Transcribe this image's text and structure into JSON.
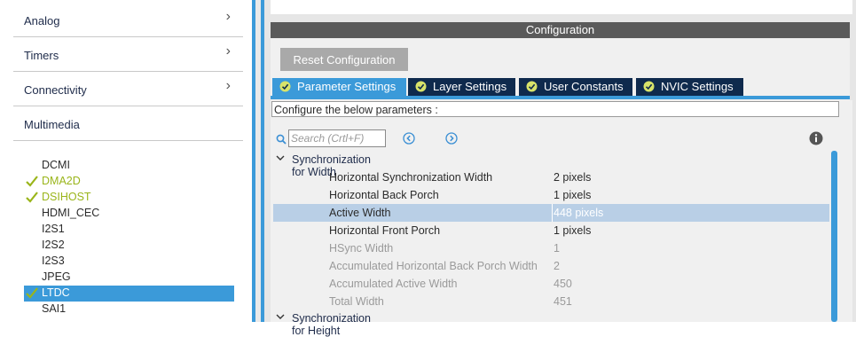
{
  "left_panel": {
    "categories": [
      {
        "label": "Analog",
        "chevron": true
      },
      {
        "label": "Timers",
        "chevron": true
      },
      {
        "label": "Connectivity",
        "chevron": true
      },
      {
        "label": "Multimedia",
        "chevron": false
      }
    ],
    "multimedia_items": [
      {
        "label": "DCMI",
        "status": "none"
      },
      {
        "label": "DMA2D",
        "status": "ok"
      },
      {
        "label": "DSIHOST",
        "status": "ok"
      },
      {
        "label": "HDMI_CEC",
        "status": "none"
      },
      {
        "label": "I2S1",
        "status": "none"
      },
      {
        "label": "I2S2",
        "status": "none"
      },
      {
        "label": "I2S3",
        "status": "none"
      },
      {
        "label": "JPEG",
        "status": "none"
      },
      {
        "label": "LTDC",
        "status": "ok-selected"
      },
      {
        "label": "SAI1",
        "status": "none"
      }
    ],
    "icons": {
      "chevron": "chevron-right-icon",
      "check": "check-icon"
    },
    "colors": {
      "selected_bg": "#3b9ad9",
      "ok_text": "#9ab51a"
    }
  },
  "config": {
    "header": "Configuration",
    "reset_label": "Reset Configuration",
    "tabs": [
      {
        "label": "Parameter Settings",
        "active": true
      },
      {
        "label": "Layer Settings",
        "active": false
      },
      {
        "label": "User Constants",
        "active": false
      },
      {
        "label": "NVIC Settings",
        "active": false
      }
    ],
    "instruction": "Configure the below parameters :",
    "search_placeholder": "Search (Crtl+F)",
    "icons": {
      "search": "search-icon",
      "prev": "previous-icon",
      "next": "next-icon",
      "info": "info-icon",
      "tab_check": "check-circle-icon"
    },
    "groups": [
      {
        "label": "Synchronization for Width",
        "params": [
          {
            "name": "Horizontal Synchronization Width",
            "value": "2 pixels",
            "dim": false
          },
          {
            "name": "Horizontal Back Porch",
            "value": "1 pixels",
            "dim": false
          },
          {
            "name": "Active Width",
            "value": "448 pixels",
            "dim": false,
            "selected": true
          },
          {
            "name": "Horizontal Front Porch",
            "value": "1 pixels",
            "dim": false
          },
          {
            "name": "HSync Width",
            "value": "1",
            "dim": true
          },
          {
            "name": "Accumulated Horizontal Back Porch Width",
            "value": "2",
            "dim": true
          },
          {
            "name": "Accumulated Active Width",
            "value": "450",
            "dim": true
          },
          {
            "name": "Total Width",
            "value": "451",
            "dim": true
          }
        ]
      },
      {
        "label": "Synchronization for Height",
        "params": []
      }
    ],
    "colors": {
      "tab_active": "#3b9ad9",
      "tab_inactive": "#0f2a4d",
      "row_selected": "#b9cfe6"
    }
  }
}
